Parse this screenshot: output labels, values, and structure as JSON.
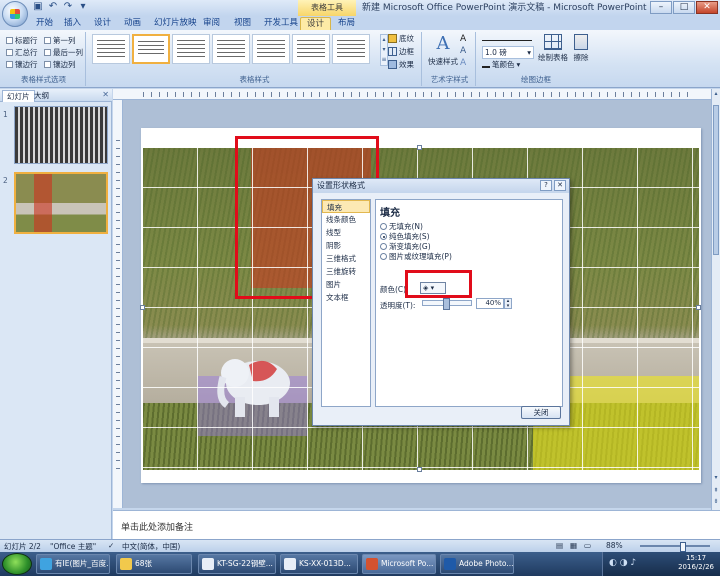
{
  "window": {
    "title": "新建 Microsoft Office PowerPoint 演示文稿 - Microsoft PowerPoint",
    "context_tool": "表格工具"
  },
  "ribbon_tabs": [
    "开始",
    "插入",
    "设计",
    "动画",
    "幻灯片放映",
    "审阅",
    "视图",
    "开发工具",
    "设计",
    "布局"
  ],
  "active_tab_index": 8,
  "table_style_options": {
    "items": [
      "标题行",
      "第一列",
      "汇总行",
      "最后一列",
      "镶边行",
      "镶边列"
    ],
    "label": "表格样式选项"
  },
  "table_styles": {
    "label": "表格样式",
    "shading": "底纹",
    "border": "边框",
    "effects": "效果"
  },
  "wordart": {
    "quick_styles": "快速样式",
    "label": "艺术字样式"
  },
  "draw_borders": {
    "pen_weight": "1.0 磅",
    "pen_color": "笔颜色",
    "draw_table": "绘制表格",
    "eraser": "擦除",
    "label": "绘图边框"
  },
  "slides_panel": {
    "tabs": [
      "幻灯片",
      "大纲"
    ],
    "slide_numbers": [
      "1",
      "2"
    ]
  },
  "dialog": {
    "title": "设置形状格式",
    "nav": [
      "填充",
      "线条颜色",
      "线型",
      "阴影",
      "三维格式",
      "三维旋转",
      "图片",
      "文本框"
    ],
    "heading": "填充",
    "options": [
      "无填充(N)",
      "纯色填充(S)",
      "渐变填充(G)",
      "图片或纹理填充(P)"
    ],
    "color_label": "颜色(C)",
    "transparency_label": "透明度(T):",
    "transparency_value": "40%",
    "close_button": "关闭"
  },
  "notes_placeholder": "单击此处添加备注",
  "status": {
    "slide": "幻灯片 2/2",
    "theme": "\"Office 主题\"",
    "language": "中文(简体，中国)",
    "zoom": "88%"
  },
  "taskbar": {
    "items": [
      "有IE(图片_百度...",
      "68张",
      "KT-SG-22钢壁...",
      "KS-XX-013D...",
      "Microsoft Po...",
      "Adobe Photo..."
    ],
    "time": "15:17",
    "date": "2016/2/26"
  }
}
